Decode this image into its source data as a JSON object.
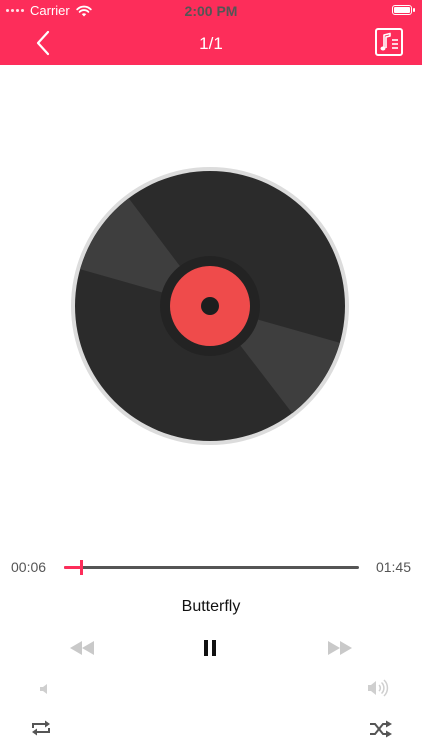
{
  "status_bar": {
    "carrier": "Carrier",
    "time": "2:00 PM"
  },
  "nav": {
    "title": "1/1",
    "back_icon": "chevron-left-icon",
    "playlist_icon": "music-list-icon"
  },
  "player": {
    "current_time": "00:06",
    "total_time": "01:45",
    "progress": 0.057,
    "song_title": "Butterfly"
  },
  "colors": {
    "accent": "#fd2d5a",
    "record_label": "#ef4b4b",
    "record_body": "#2b2b2b"
  }
}
